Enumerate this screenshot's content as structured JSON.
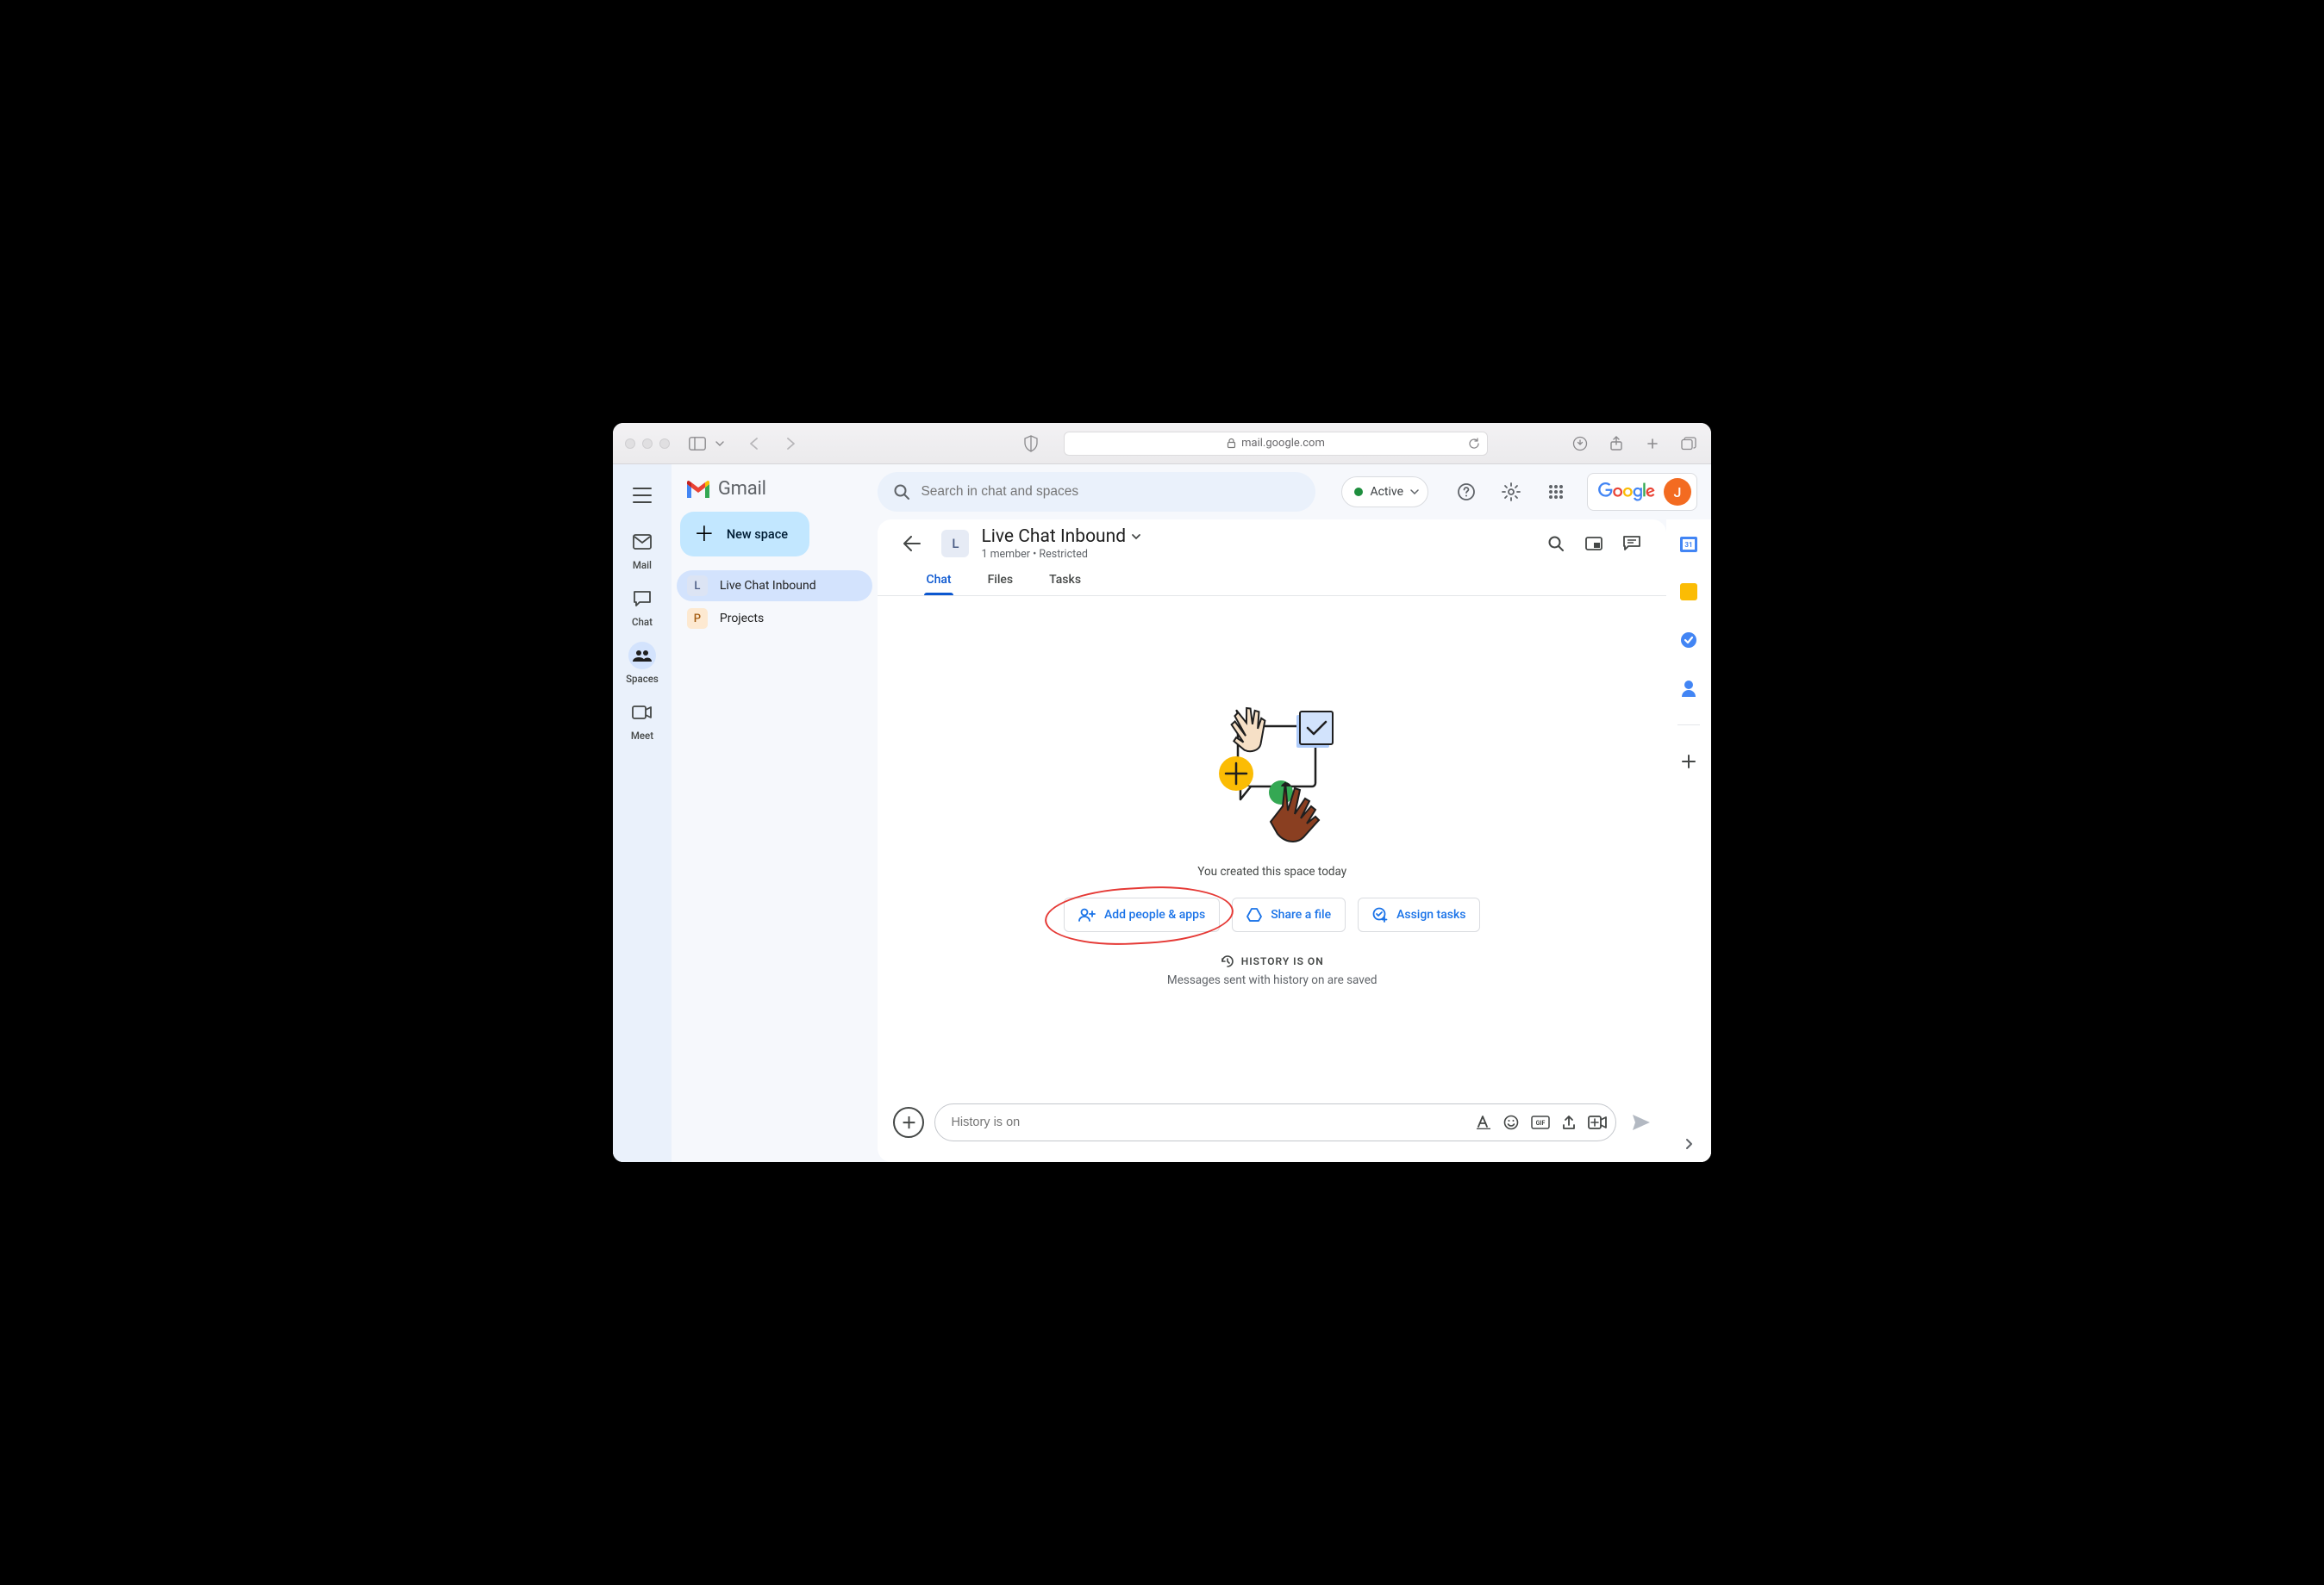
{
  "browser": {
    "url": "mail.google.com"
  },
  "gmail": {
    "product": "Gmail",
    "search_placeholder": "Search in chat and spaces",
    "status": "Active",
    "google_logo_alt": "Google",
    "avatar_initial": "J"
  },
  "rail": {
    "items": [
      {
        "label": "Mail"
      },
      {
        "label": "Chat"
      },
      {
        "label": "Spaces"
      },
      {
        "label": "Meet"
      }
    ]
  },
  "spaces_sidebar": {
    "new_space_label": "New space",
    "items": [
      {
        "initial": "L",
        "name": "Live Chat Inbound",
        "active": true
      },
      {
        "initial": "P",
        "name": "Projects",
        "active": false
      }
    ]
  },
  "panel": {
    "title": "Live Chat Inbound",
    "subtitle": "1 member  •  Restricted",
    "tabs": [
      {
        "label": "Chat",
        "active": true
      },
      {
        "label": "Files",
        "active": false
      },
      {
        "label": "Tasks",
        "active": false
      }
    ],
    "created_text": "You created this space today",
    "actions": {
      "add_people": "Add people & apps",
      "share_file": "Share a file",
      "assign_tasks": "Assign tasks"
    },
    "history_label": "HISTORY IS ON",
    "history_sub": "Messages sent with history on are saved",
    "composer_placeholder": "History is on"
  }
}
